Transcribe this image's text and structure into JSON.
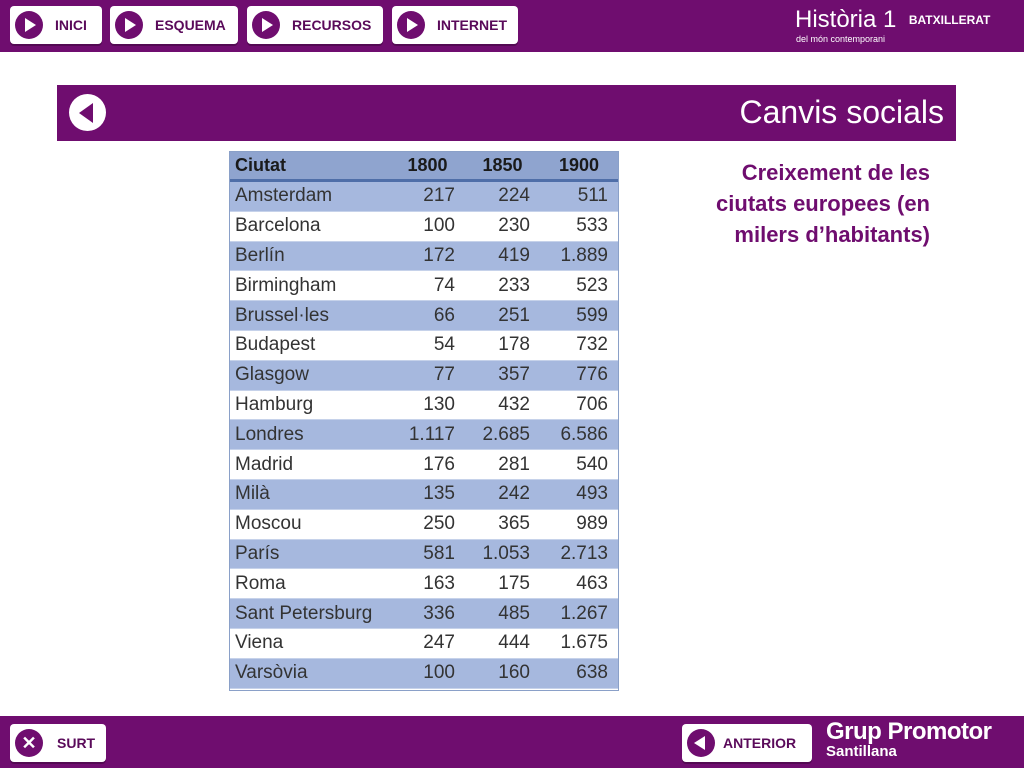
{
  "nav": {
    "buttons": [
      {
        "label": "INICI"
      },
      {
        "label": "ESQUEMA"
      },
      {
        "label": "RECURSOS"
      },
      {
        "label": "INTERNET"
      }
    ]
  },
  "brand": {
    "title": "Història 1",
    "level": "BATXILLERAT",
    "subtitle": "del món contemporani"
  },
  "header": {
    "title": "Canvis socials",
    "back_icon": "arrow-left-icon"
  },
  "table": {
    "columns": [
      "Ciutat",
      "1800",
      "1850",
      "1900"
    ],
    "rows": [
      [
        "Amsterdam",
        "217",
        "224",
        "511"
      ],
      [
        "Barcelona",
        "100",
        "230",
        "533"
      ],
      [
        "Berlín",
        "172",
        "419",
        "1.889"
      ],
      [
        "Birmingham",
        "74",
        "233",
        "523"
      ],
      [
        "Brussel·les",
        "66",
        "251",
        "599"
      ],
      [
        "Budapest",
        "54",
        "178",
        "732"
      ],
      [
        "Glasgow",
        "77",
        "357",
        "776"
      ],
      [
        "Hamburg",
        "130",
        "432",
        "706"
      ],
      [
        "Londres",
        "1.117",
        "2.685",
        "6.586"
      ],
      [
        "Madrid",
        "176",
        "281",
        "540"
      ],
      [
        "Milà",
        "135",
        "242",
        "493"
      ],
      [
        "Moscou",
        "250",
        "365",
        "989"
      ],
      [
        "París",
        "581",
        "1.053",
        "2.713"
      ],
      [
        "Roma",
        "163",
        "175",
        "463"
      ],
      [
        "Sant Petersburg",
        "336",
        "485",
        "1.267"
      ],
      [
        "Viena",
        "247",
        "444",
        "1.675"
      ],
      [
        "Varsòvia",
        "100",
        "160",
        "638"
      ]
    ]
  },
  "caption": "Creixement de les ciutats europees (en milers d’habitants)",
  "footer": {
    "exit_label": "SURT",
    "prev_label": "ANTERIOR",
    "logo_line1": "Grup Promotor",
    "logo_line2": "Santillana"
  },
  "colors": {
    "brand_purple": "#6f0d6f",
    "table_header": "#8fa4cf",
    "table_row_alt": "#a6b8de"
  }
}
